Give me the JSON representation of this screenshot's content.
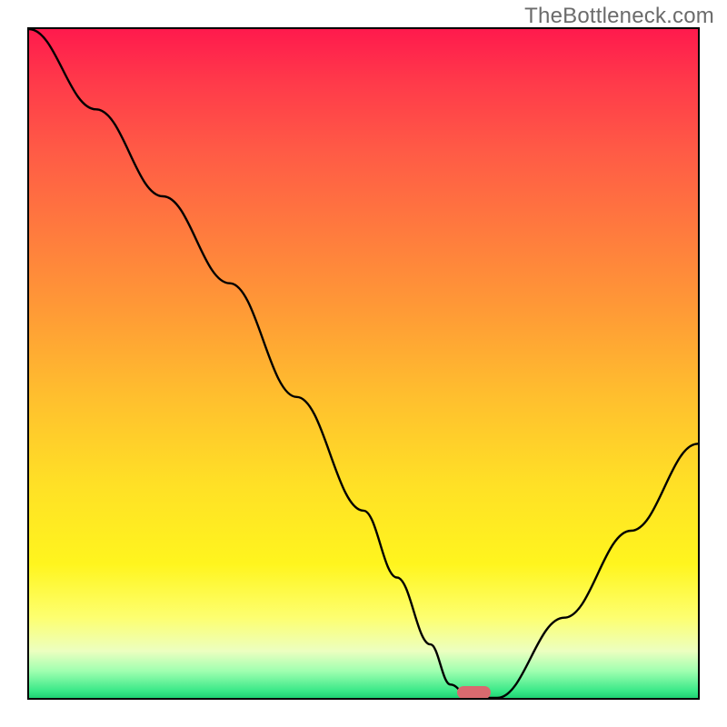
{
  "watermark": "TheBottleneck.com",
  "chart_data": {
    "type": "line",
    "title": "",
    "xlabel": "",
    "ylabel": "",
    "xlim": [
      0,
      100
    ],
    "ylim": [
      0,
      100
    ],
    "grid": false,
    "background_gradient": {
      "direction": "vertical",
      "stops": [
        {
          "pos": 0,
          "color": "#ff1a4d"
        },
        {
          "pos": 50,
          "color": "#ffc02e"
        },
        {
          "pos": 80,
          "color": "#fff51e"
        },
        {
          "pos": 100,
          "color": "#1fd173"
        }
      ]
    },
    "series": [
      {
        "name": "bottleneck-curve",
        "color": "#000000",
        "x": [
          0,
          10,
          20,
          30,
          40,
          50,
          55,
          60,
          63,
          66,
          70,
          80,
          90,
          100
        ],
        "y": [
          100,
          88,
          75,
          62,
          45,
          28,
          18,
          8,
          2,
          0,
          0,
          12,
          25,
          38
        ]
      }
    ],
    "annotations": [
      {
        "name": "optimal-marker",
        "shape": "rounded-rect",
        "color": "#d96a6f",
        "x": 66.5,
        "y": 0.8,
        "width_pct": 5.1,
        "height_pct": 1.9
      }
    ]
  }
}
